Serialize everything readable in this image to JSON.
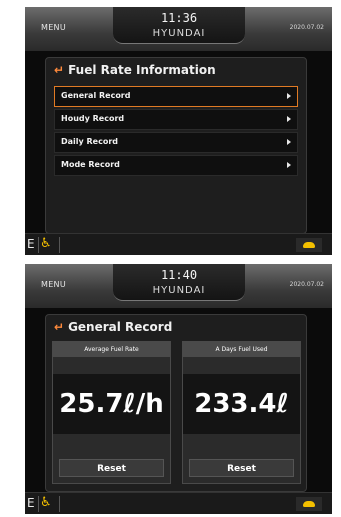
{
  "screen1": {
    "header": {
      "menu_label": "MENU",
      "time": "11:36",
      "brand": "HYUNDAI",
      "date": "2020.07.02"
    },
    "panel": {
      "title": "Fuel Rate Information",
      "items": [
        {
          "label": "General Record",
          "selected": true
        },
        {
          "label": "Houdy Record"
        },
        {
          "label": "Daily Record"
        },
        {
          "label": "Mode Record"
        }
      ]
    },
    "bottom": {
      "mode_letter": "E",
      "icons": [
        "person-icon",
        "fish-icon"
      ]
    }
  },
  "screen2": {
    "header": {
      "menu_label": "MENU",
      "time": "11:40",
      "brand": "HYUNDAI",
      "date": "2020.07.02"
    },
    "panel": {
      "title": "General Record",
      "cards": [
        {
          "label": "Average Fuel Rate",
          "value": "25.7ℓ/h",
          "button": "Reset"
        },
        {
          "label": "A Days Fuel Used",
          "value": "233.4ℓ",
          "button": "Reset"
        }
      ]
    },
    "bottom": {
      "mode_letter": "E",
      "icons": [
        "person-icon",
        "fish-icon"
      ]
    }
  },
  "colors": {
    "accent": "#e07a24",
    "indicator": "#f4c000",
    "background": "#0b0b0b"
  }
}
